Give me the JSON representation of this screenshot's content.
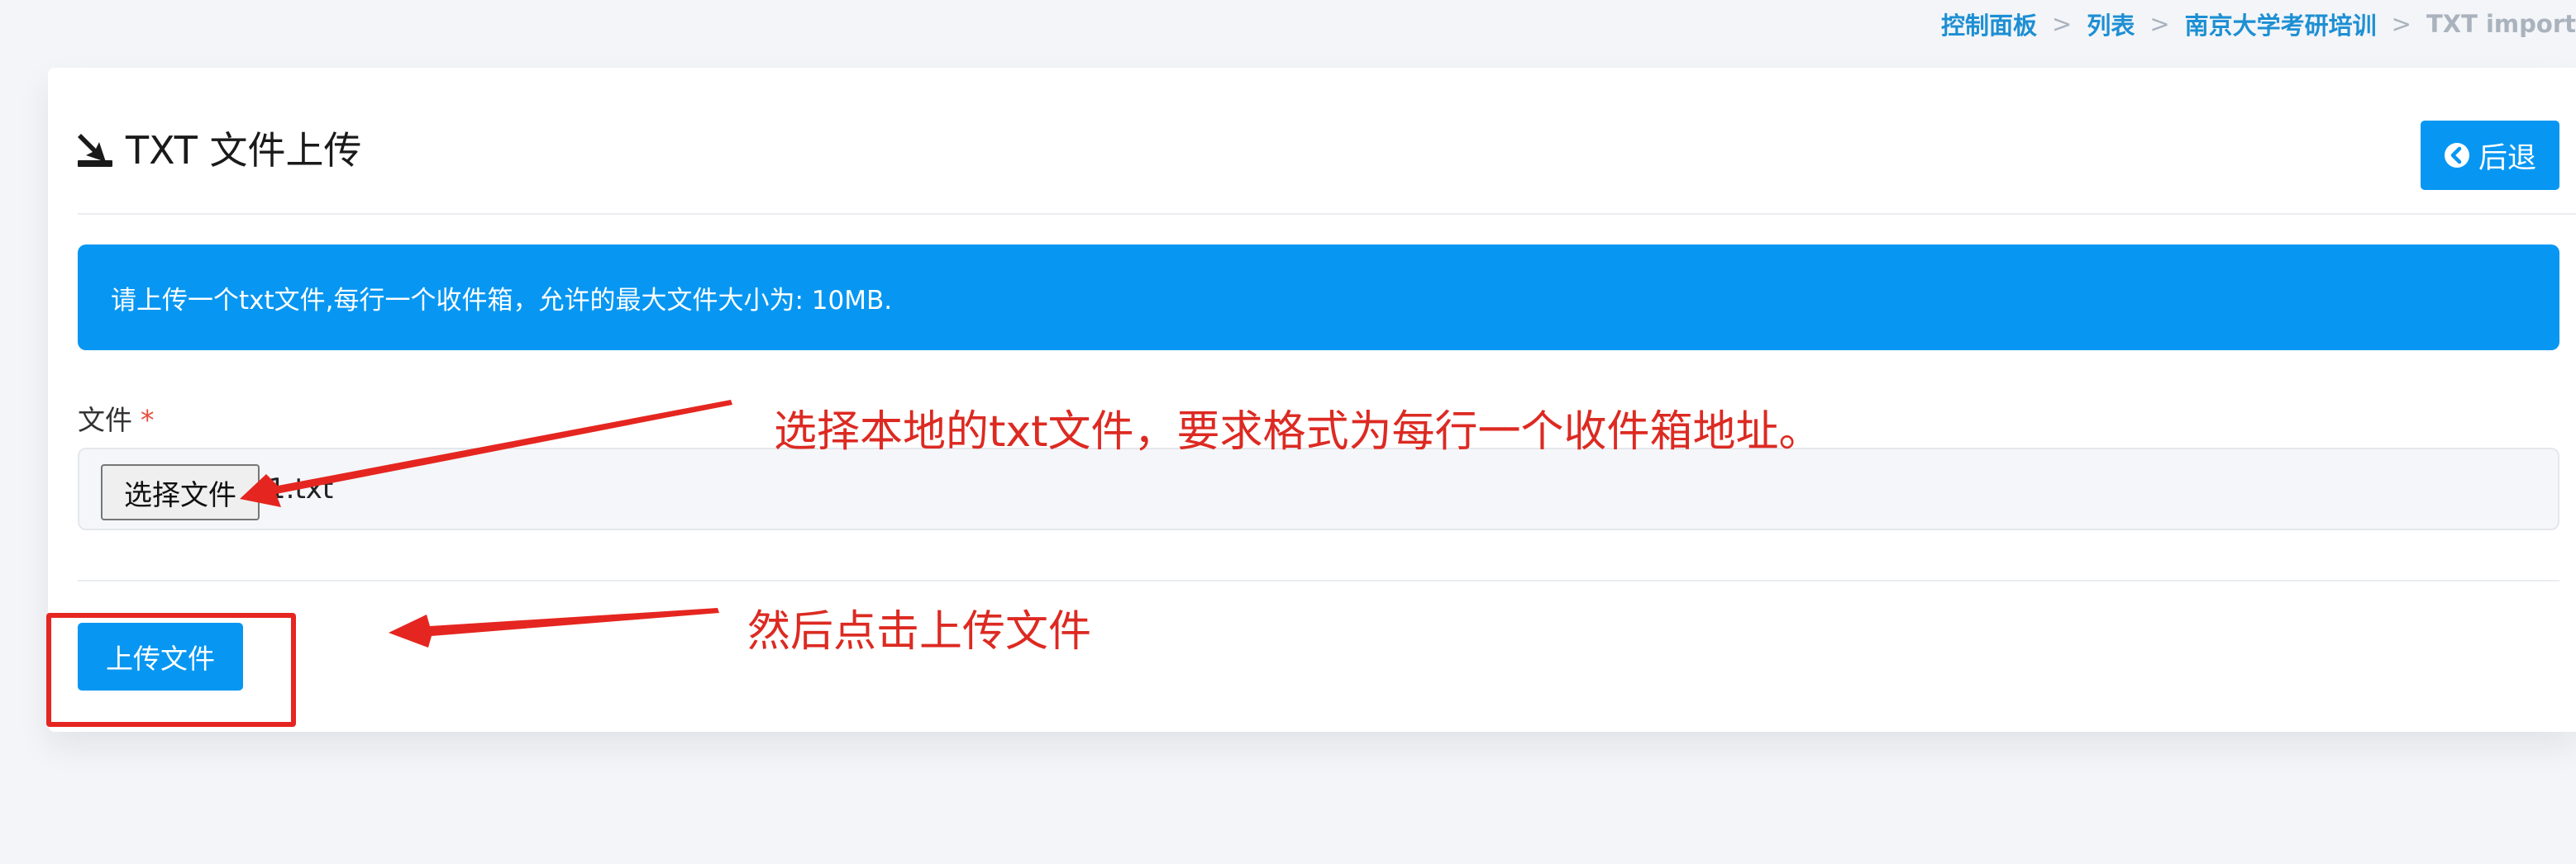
{
  "breadcrumb": {
    "items": [
      "控制面板",
      "列表",
      "南京大学考研培训"
    ],
    "current": "TXT import",
    "separator": ">"
  },
  "header": {
    "title": "TXT 文件上传",
    "title_icon": "upload-icon",
    "back_label": "后退",
    "back_icon": "circle-arrow-left-icon"
  },
  "alert": {
    "text": "请上传一个txt文件,每行一个收件箱，允许的最大文件大小为: 10MB."
  },
  "file_field": {
    "label": "文件",
    "required_mark": "*",
    "choose_label": "选择文件",
    "file_name": "1.txt"
  },
  "actions": {
    "upload_label": "上传文件"
  },
  "annotations": {
    "step1": "选择本地的txt文件，要求格式为每行一个收件箱地址。",
    "step2": "然后点击上传文件",
    "color": "#dc2a22"
  },
  "colors": {
    "accent": "#0797f2",
    "breadcrumb_link": "#1d8fd3",
    "breadcrumb_muted": "#aab3bd",
    "background": "#f3f5f8"
  }
}
